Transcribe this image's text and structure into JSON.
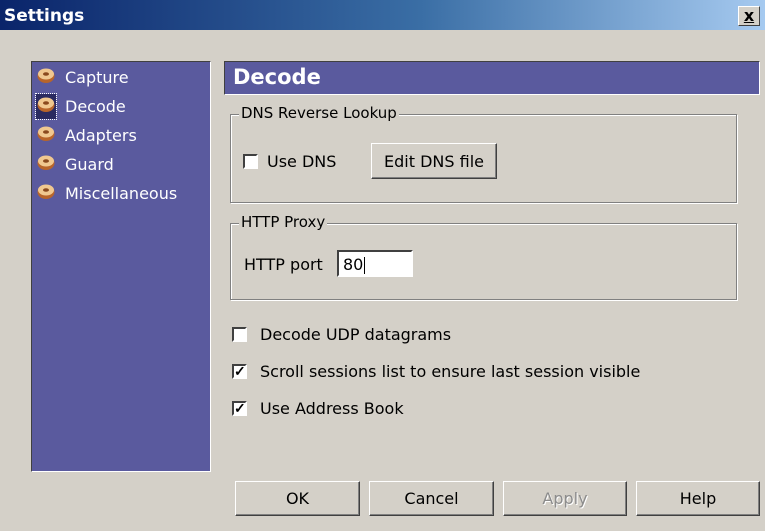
{
  "window": {
    "title": "Settings",
    "close_glyph": "x"
  },
  "sidebar": {
    "items": [
      {
        "label": "Capture",
        "icon": "donut-icon",
        "selected": false
      },
      {
        "label": "Decode",
        "icon": "donut-icon",
        "selected": true
      },
      {
        "label": "Adapters",
        "icon": "donut-icon",
        "selected": false
      },
      {
        "label": "Guard",
        "icon": "donut-icon",
        "selected": false
      },
      {
        "label": "Miscellaneous",
        "icon": "donut-icon",
        "selected": false
      }
    ]
  },
  "section": {
    "title": "Decode"
  },
  "dns": {
    "group_label": "DNS Reverse Lookup",
    "use_dns_label": "Use DNS",
    "use_dns_checked": false,
    "edit_button_label": "Edit DNS file"
  },
  "proxy": {
    "group_label": "HTTP Proxy",
    "port_label": "HTTP port",
    "port_value": "80"
  },
  "options": [
    {
      "label": "Decode UDP datagrams",
      "checked": false
    },
    {
      "label": "Scroll sessions list to ensure last session visible",
      "checked": true
    },
    {
      "label": "Use Address Book",
      "checked": true
    }
  ],
  "buttons": {
    "ok": "OK",
    "cancel": "Cancel",
    "apply": "Apply",
    "help": "Help"
  },
  "colors": {
    "panel": "#5a5a9e",
    "dialog": "#d4d0c8",
    "title_start": "#0a246a",
    "title_end": "#a6caf0"
  }
}
